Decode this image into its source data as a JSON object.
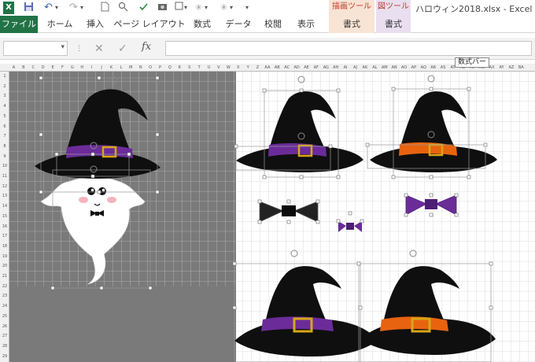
{
  "app": {
    "title": "ハロウィン2018.xlsx - Excel"
  },
  "quick_access": {
    "excel_logo": "X",
    "save_icon": "floppy-disk-icon",
    "undo_icon": "undo-icon",
    "redo_icon": "redo-icon"
  },
  "context_groups": [
    {
      "label": "描画ツール",
      "color": "#f8e4d4"
    },
    {
      "label": "図ツール",
      "color": "#e9dff1"
    }
  ],
  "ribbon": {
    "tabs": [
      "ファイル",
      "ホーム",
      "挿入",
      "ページ レイアウト",
      "数式",
      "データ",
      "校閲",
      "表示",
      "書式",
      "書式"
    ]
  },
  "formula_bar": {
    "name_box": "",
    "formula": "",
    "fx_label": "fx"
  },
  "tooltip": {
    "text": "数式バー"
  },
  "columns": [
    "A",
    "B",
    "C",
    "D",
    "E",
    "F",
    "G",
    "H",
    "I",
    "J",
    "K",
    "L",
    "M",
    "N",
    "O",
    "P",
    "Q",
    "R",
    "S",
    "T",
    "U",
    "V",
    "W",
    "X",
    "Y",
    "Z",
    "AA",
    "AB",
    "AC",
    "AD",
    "AE",
    "AF",
    "AG",
    "AH",
    "AI",
    "AJ",
    "AK",
    "AL",
    "AM",
    "AN",
    "AO",
    "AP",
    "AQ",
    "AR",
    "AS",
    "AT",
    "AU",
    "AV",
    "AW",
    "AX",
    "AY",
    "AZ",
    "BA"
  ],
  "rows": [
    "1",
    "2",
    "3",
    "4",
    "5",
    "6",
    "7",
    "8",
    "9",
    "10",
    "11",
    "12",
    "13",
    "14",
    "15",
    "16",
    "17",
    "18",
    "19",
    "20",
    "21",
    "22",
    "23",
    "24",
    "25",
    "26",
    "27",
    "28",
    "29"
  ],
  "colors": {
    "excel_green": "#217346",
    "hat_black": "#0f0f0f",
    "band_purple": "#6b2c9a",
    "band_orange": "#e8630f",
    "buckle_gold": "#d8a618",
    "sheet_gray": "#7a7a7a"
  }
}
